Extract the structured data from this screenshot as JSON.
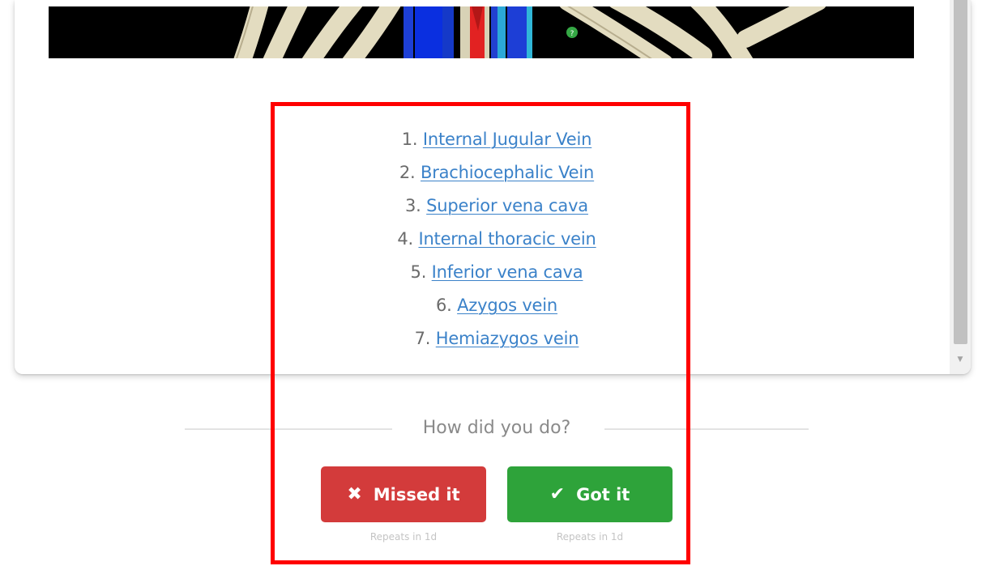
{
  "structures": [
    {
      "number": "1.",
      "label": "Internal Jugular Vein"
    },
    {
      "number": "2.",
      "label": "Brachiocephalic Vein"
    },
    {
      "number": "3.",
      "label": "Superior vena cava"
    },
    {
      "number": "4.",
      "label": "Internal thoracic vein"
    },
    {
      "number": "5.",
      "label": "Inferior vena cava"
    },
    {
      "number": "6.",
      "label": "Azygos vein"
    },
    {
      "number": "7.",
      "label": "Hemiazygos vein"
    }
  ],
  "review": {
    "prompt": "How did you do?",
    "missed_label": "Missed it",
    "missed_icon": "x-icon",
    "missed_repeat": "Repeats in 1d",
    "got_label": "Got it",
    "got_icon": "check-icon",
    "got_repeat": "Repeats in 1d"
  },
  "colors": {
    "missed": "#d33b3b",
    "got": "#2ea33a",
    "link": "#3b82c9",
    "highlight": "#ff0000"
  }
}
